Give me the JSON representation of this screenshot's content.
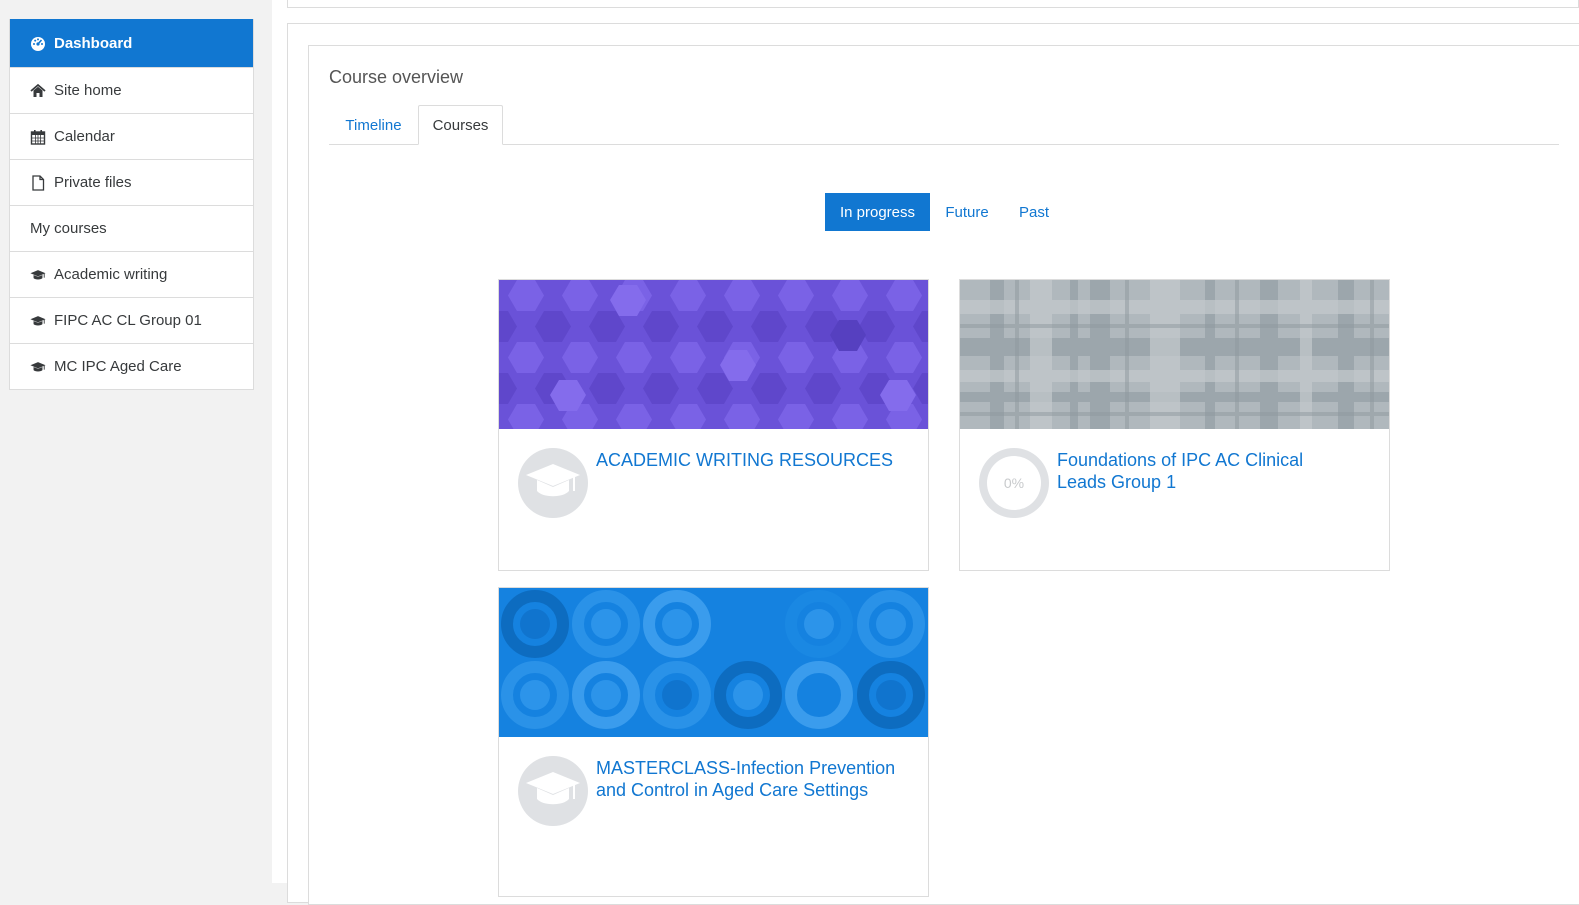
{
  "sidebar": {
    "items": [
      {
        "label": "Dashboard",
        "icon": "dashboard-icon",
        "active": true
      },
      {
        "label": "Site home",
        "icon": "home-icon"
      },
      {
        "label": "Calendar",
        "icon": "calendar-icon"
      },
      {
        "label": "Private files",
        "icon": "file-icon"
      },
      {
        "label": "My courses",
        "icon": ""
      },
      {
        "label": "Academic writing",
        "icon": "graduation-cap-icon"
      },
      {
        "label": "FIPC AC CL Group 01",
        "icon": "graduation-cap-icon"
      },
      {
        "label": "MC IPC Aged Care",
        "icon": "graduation-cap-icon"
      }
    ]
  },
  "block": {
    "title": "Course overview",
    "tabs": [
      {
        "label": "Timeline",
        "active": false
      },
      {
        "label": "Courses",
        "active": true
      }
    ],
    "filters": [
      {
        "label": "In progress",
        "active": true
      },
      {
        "label": "Future",
        "active": false
      },
      {
        "label": "Past",
        "active": false
      }
    ]
  },
  "courses": [
    {
      "title": "ACADEMIC WRITING RESOURCES",
      "banner_color": "#6b52d6",
      "badge": "graduation-cap-icon"
    },
    {
      "title": "Foundations of IPC AC Clinical Leads Group 1",
      "banner_color": "#a7b0b6",
      "badge": "progress",
      "progress_text": "0%",
      "progress": 0
    },
    {
      "title": "MASTERCLASS-Infection Prevention and Control in Aged Care Settings",
      "banner_color": "#1884e0",
      "badge": "graduation-cap-icon"
    }
  ],
  "colors": {
    "accent": "#1177d1",
    "sidebar_bg": "#f2f2f2"
  }
}
